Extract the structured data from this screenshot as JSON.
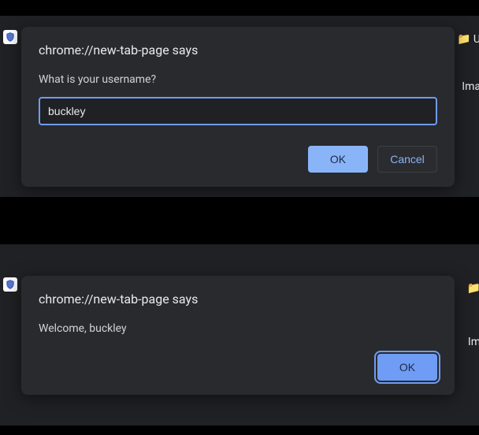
{
  "top": {
    "dialog_title": "chrome://new-tab-page says",
    "dialog_message": "What is your username?",
    "input_value": "buckley",
    "ok_label": "OK",
    "cancel_label": "Cancel",
    "right_glyph": "📁",
    "right_text1": "U",
    "right_text2": "Ima"
  },
  "bot": {
    "dialog_title": "chrome://new-tab-page says",
    "dialog_message": "Welcome, buckley",
    "ok_label": "OK",
    "right_glyph": "📁",
    "right_text2": "Im"
  }
}
